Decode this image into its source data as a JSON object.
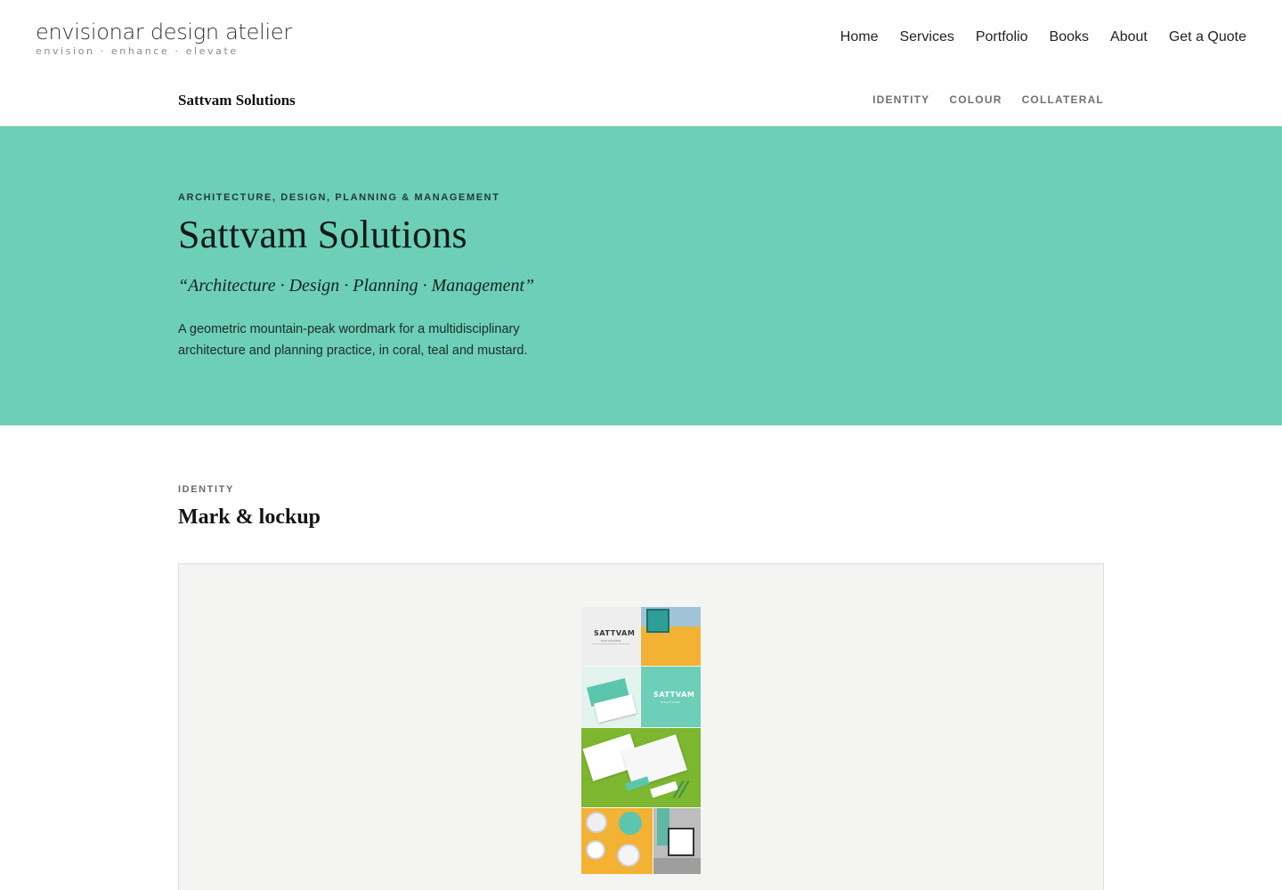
{
  "site": {
    "logo_name": "envisionar design atelier",
    "logo_tagline": "envision · enhance · elevate",
    "nav": [
      "Home",
      "Services",
      "Portfolio",
      "Books",
      "About",
      "Get a Quote"
    ]
  },
  "project_bar": {
    "name": "Sattvam Solutions",
    "subnav": [
      "IDENTITY",
      "COLOUR",
      "COLLATERAL"
    ]
  },
  "hero": {
    "eyebrow": "ARCHITECTURE, DESIGN, PLANNING & MANAGEMENT",
    "title": "Sattvam Solutions",
    "quote": "“Architecture · Design · Planning · Management”",
    "description": "A geometric mountain-peak wordmark for a multidisciplinary architecture and planning practice, in coral, teal and mustard."
  },
  "identity": {
    "eyebrow": "IDENTITY",
    "title": "Mark & lockup"
  },
  "collage": {
    "wordmark": "SATTVAM",
    "wordmark_sub": "SOLUTIONS"
  },
  "colors": {
    "hero_bg": "#6dcfb7",
    "teal": "#6dcfb7",
    "mustard": "#f3b233",
    "green": "#7db730",
    "frame_bg": "#f4f4f2"
  }
}
